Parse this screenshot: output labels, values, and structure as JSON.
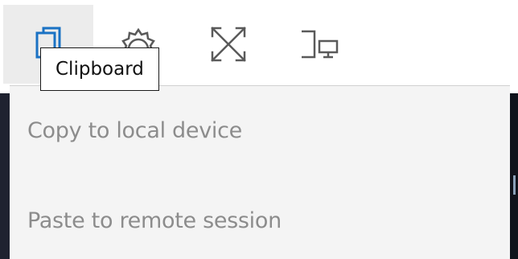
{
  "toolbar": {
    "buttons": [
      {
        "icon": "clipboard-icon",
        "active": true
      },
      {
        "icon": "gear-icon",
        "active": false
      },
      {
        "icon": "fullscreen-icon",
        "active": false
      },
      {
        "icon": "display-devices-icon",
        "active": false
      }
    ],
    "accent_color": "#1a72c4",
    "icon_color": "#5a5a5a"
  },
  "tooltip": {
    "text": "Clipboard"
  },
  "menu": {
    "items": [
      {
        "label": "Copy to local device"
      },
      {
        "label": "Paste to remote session"
      }
    ],
    "text_color": "#8c8c8c",
    "background": "#f4f4f4"
  }
}
